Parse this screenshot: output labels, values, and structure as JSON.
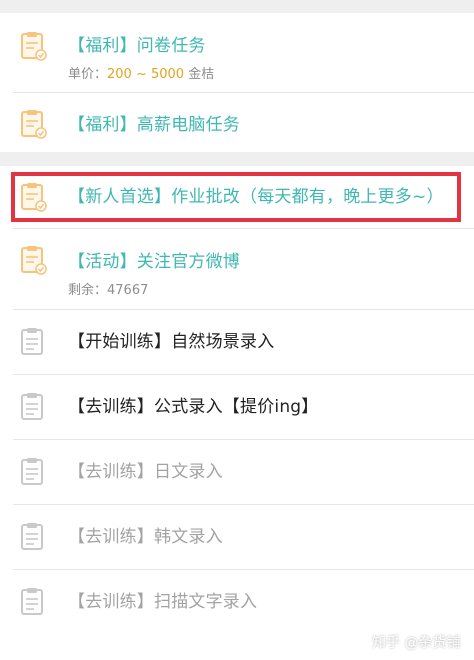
{
  "colors": {
    "teal": "#3fb8b1",
    "price_yellow": "#e0a420",
    "highlight_red": "#e43343",
    "icon_orange": "#f7c47e",
    "icon_gray": "#c9c9c9"
  },
  "tasks": [
    {
      "title": "【福利】问卷任务",
      "sub_prefix": "单价：",
      "sub_value": "200 ~ 5000",
      "sub_suffix": " 金桔",
      "style": "teal",
      "icon": "clipboard-check-icon"
    },
    {
      "title": "【福利】高薪电脑任务",
      "style": "teal",
      "icon": "clipboard-check-icon"
    },
    {
      "title": "【新人首选】作业批改（每天都有，晚上更多~）",
      "style": "teal",
      "icon": "clipboard-check-icon",
      "highlighted": true
    },
    {
      "title": "【活动】关注官方微博",
      "sub_prefix": "剩余：",
      "sub_value": "47667",
      "style": "teal",
      "icon": "clipboard-check-icon"
    },
    {
      "title": "【开始训练】自然场景录入",
      "style": "dark",
      "icon": "clipboard-icon"
    },
    {
      "title": "【去训练】公式录入【提价ing】",
      "style": "dark",
      "icon": "clipboard-icon"
    },
    {
      "title": "【去训练】日文录入",
      "style": "gray",
      "icon": "clipboard-icon"
    },
    {
      "title": "【去训练】韩文录入",
      "style": "gray",
      "icon": "clipboard-icon"
    },
    {
      "title": "【去训练】扫描文字录入",
      "style": "gray",
      "icon": "clipboard-icon"
    }
  ],
  "watermark": "知乎 @杂货铺"
}
